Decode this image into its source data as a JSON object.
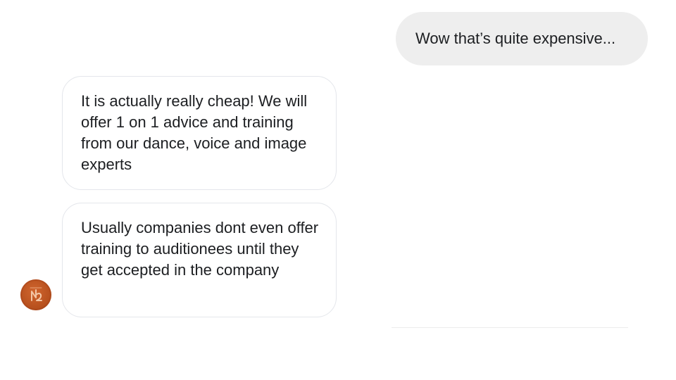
{
  "conversation": {
    "messages": [
      {
        "sender": "me",
        "text": "Wow that’s quite expensive..."
      },
      {
        "sender": "them",
        "text": "It is actually really cheap! We will offer 1 on 1 advice and training from our dance, voice and image experts"
      },
      {
        "sender": "them",
        "text": "Usually companies dont even offer training to auditionees until they get accepted in the company"
      }
    ]
  },
  "colors": {
    "outgoing_bubble": "#eeeeee",
    "incoming_border": "#e4e6eb",
    "avatar": "#c05a24"
  },
  "icons": {
    "avatar": "contact-avatar-icon"
  }
}
